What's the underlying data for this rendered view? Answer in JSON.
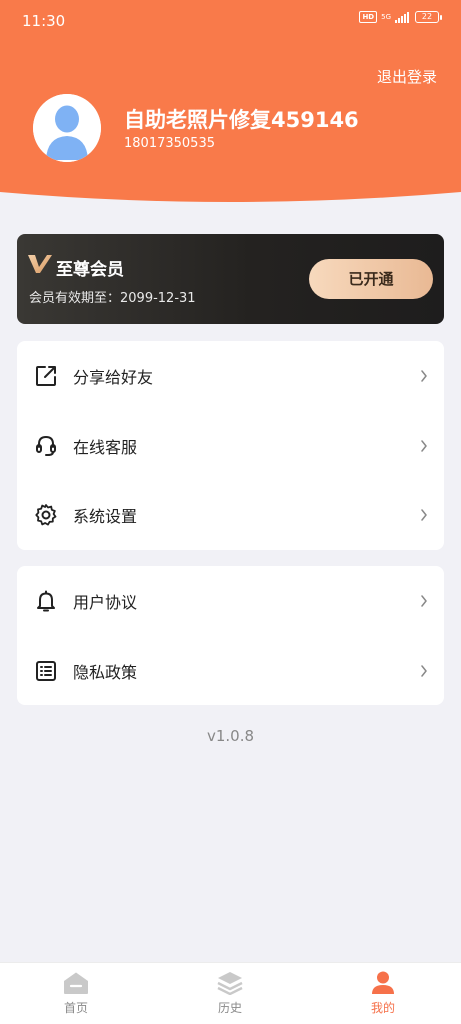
{
  "status_bar": {
    "time": "11:30",
    "hd": "HD",
    "network": "5G",
    "battery": "22"
  },
  "header": {
    "logout_label": "退出登录",
    "user_name": "自助老照片修复459146",
    "phone": "18017350535",
    "bg_color": "#f97a4a"
  },
  "vip": {
    "logo": "V",
    "title": "至尊会员",
    "expiry": "会员有效期至：2099-12-31",
    "button_label": "已开通"
  },
  "menu_group_1": [
    {
      "label": "分享给好友",
      "icon": "share-icon"
    },
    {
      "label": "在线客服",
      "icon": "headset-icon"
    },
    {
      "label": "系统设置",
      "icon": "gear-icon"
    }
  ],
  "menu_group_2": [
    {
      "label": "用户协议",
      "icon": "bell-icon"
    },
    {
      "label": "隐私政策",
      "icon": "list-icon"
    }
  ],
  "version": "v1.0.8",
  "tabbar": {
    "tabs": [
      {
        "label": "首页",
        "icon": "home-icon"
      },
      {
        "label": "历史",
        "icon": "layers-icon"
      },
      {
        "label": "我的",
        "icon": "profile-icon"
      }
    ],
    "active_color": "#f6714a"
  }
}
